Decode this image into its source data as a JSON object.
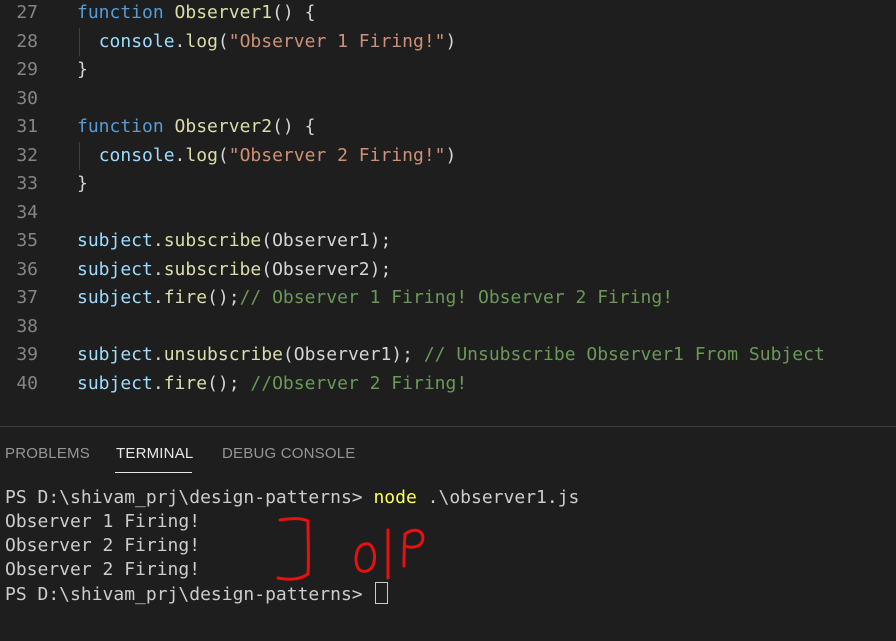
{
  "editor": {
    "lines": [
      {
        "num": "27",
        "tokens": [
          [
            "function",
            "kw"
          ],
          [
            " ",
            "plain"
          ],
          [
            "Observer1",
            "fn"
          ],
          [
            "() {",
            "plain"
          ]
        ]
      },
      {
        "num": "28",
        "tokens": [
          [
            "  ",
            "plain"
          ],
          [
            "console",
            "var"
          ],
          [
            ".",
            "plain"
          ],
          [
            "log",
            "fn"
          ],
          [
            "(",
            "plain"
          ],
          [
            "\"Observer 1 Firing!\"",
            "str"
          ],
          [
            ")",
            "plain"
          ]
        ]
      },
      {
        "num": "29",
        "tokens": [
          [
            "}",
            "plain"
          ]
        ]
      },
      {
        "num": "30",
        "tokens": []
      },
      {
        "num": "31",
        "tokens": [
          [
            "function",
            "kw"
          ],
          [
            " ",
            "plain"
          ],
          [
            "Observer2",
            "fn"
          ],
          [
            "() {",
            "plain"
          ]
        ]
      },
      {
        "num": "32",
        "tokens": [
          [
            "  ",
            "plain"
          ],
          [
            "console",
            "var"
          ],
          [
            ".",
            "plain"
          ],
          [
            "log",
            "fn"
          ],
          [
            "(",
            "plain"
          ],
          [
            "\"Observer 2 Firing!\"",
            "str"
          ],
          [
            ")",
            "plain"
          ]
        ]
      },
      {
        "num": "33",
        "tokens": [
          [
            "}",
            "plain"
          ]
        ]
      },
      {
        "num": "34",
        "tokens": []
      },
      {
        "num": "35",
        "tokens": [
          [
            "subject",
            "var"
          ],
          [
            ".",
            "plain"
          ],
          [
            "subscribe",
            "fn"
          ],
          [
            "(Observer1);",
            "plain"
          ]
        ]
      },
      {
        "num": "36",
        "tokens": [
          [
            "subject",
            "var"
          ],
          [
            ".",
            "plain"
          ],
          [
            "subscribe",
            "fn"
          ],
          [
            "(Observer2);",
            "plain"
          ]
        ]
      },
      {
        "num": "37",
        "tokens": [
          [
            "subject",
            "var"
          ],
          [
            ".",
            "plain"
          ],
          [
            "fire",
            "fn"
          ],
          [
            "();",
            "plain"
          ],
          [
            "// Observer 1 Firing! Observer 2 Firing!",
            "com"
          ]
        ]
      },
      {
        "num": "38",
        "tokens": []
      },
      {
        "num": "39",
        "tokens": [
          [
            "subject",
            "var"
          ],
          [
            ".",
            "plain"
          ],
          [
            "unsubscribe",
            "fn"
          ],
          [
            "(Observer1); ",
            "plain"
          ],
          [
            "// Unsubscribe Observer1 From Subject",
            "com"
          ]
        ]
      },
      {
        "num": "40",
        "tokens": [
          [
            "subject",
            "var"
          ],
          [
            ".",
            "plain"
          ],
          [
            "fire",
            "fn"
          ],
          [
            "(); ",
            "plain"
          ],
          [
            "//Observer 2 Firing!",
            "com"
          ]
        ]
      }
    ]
  },
  "panel": {
    "tabs": [
      {
        "label": "PROBLEMS",
        "active": false
      },
      {
        "label": "TERMINAL",
        "active": true
      },
      {
        "label": "DEBUG CONSOLE",
        "active": false
      }
    ]
  },
  "terminal": {
    "prompt1": "PS D:\\shivam_prj\\design-patterns> ",
    "command": "node",
    "args": " .\\observer1.js",
    "output": [
      "Observer 1 Firing!",
      "Observer 2 Firing!",
      "Observer 2 Firing!"
    ],
    "prompt2": "PS D:\\shivam_prj\\design-patterns> "
  },
  "annotation": {
    "text": "O|P",
    "color": "#e81010"
  }
}
